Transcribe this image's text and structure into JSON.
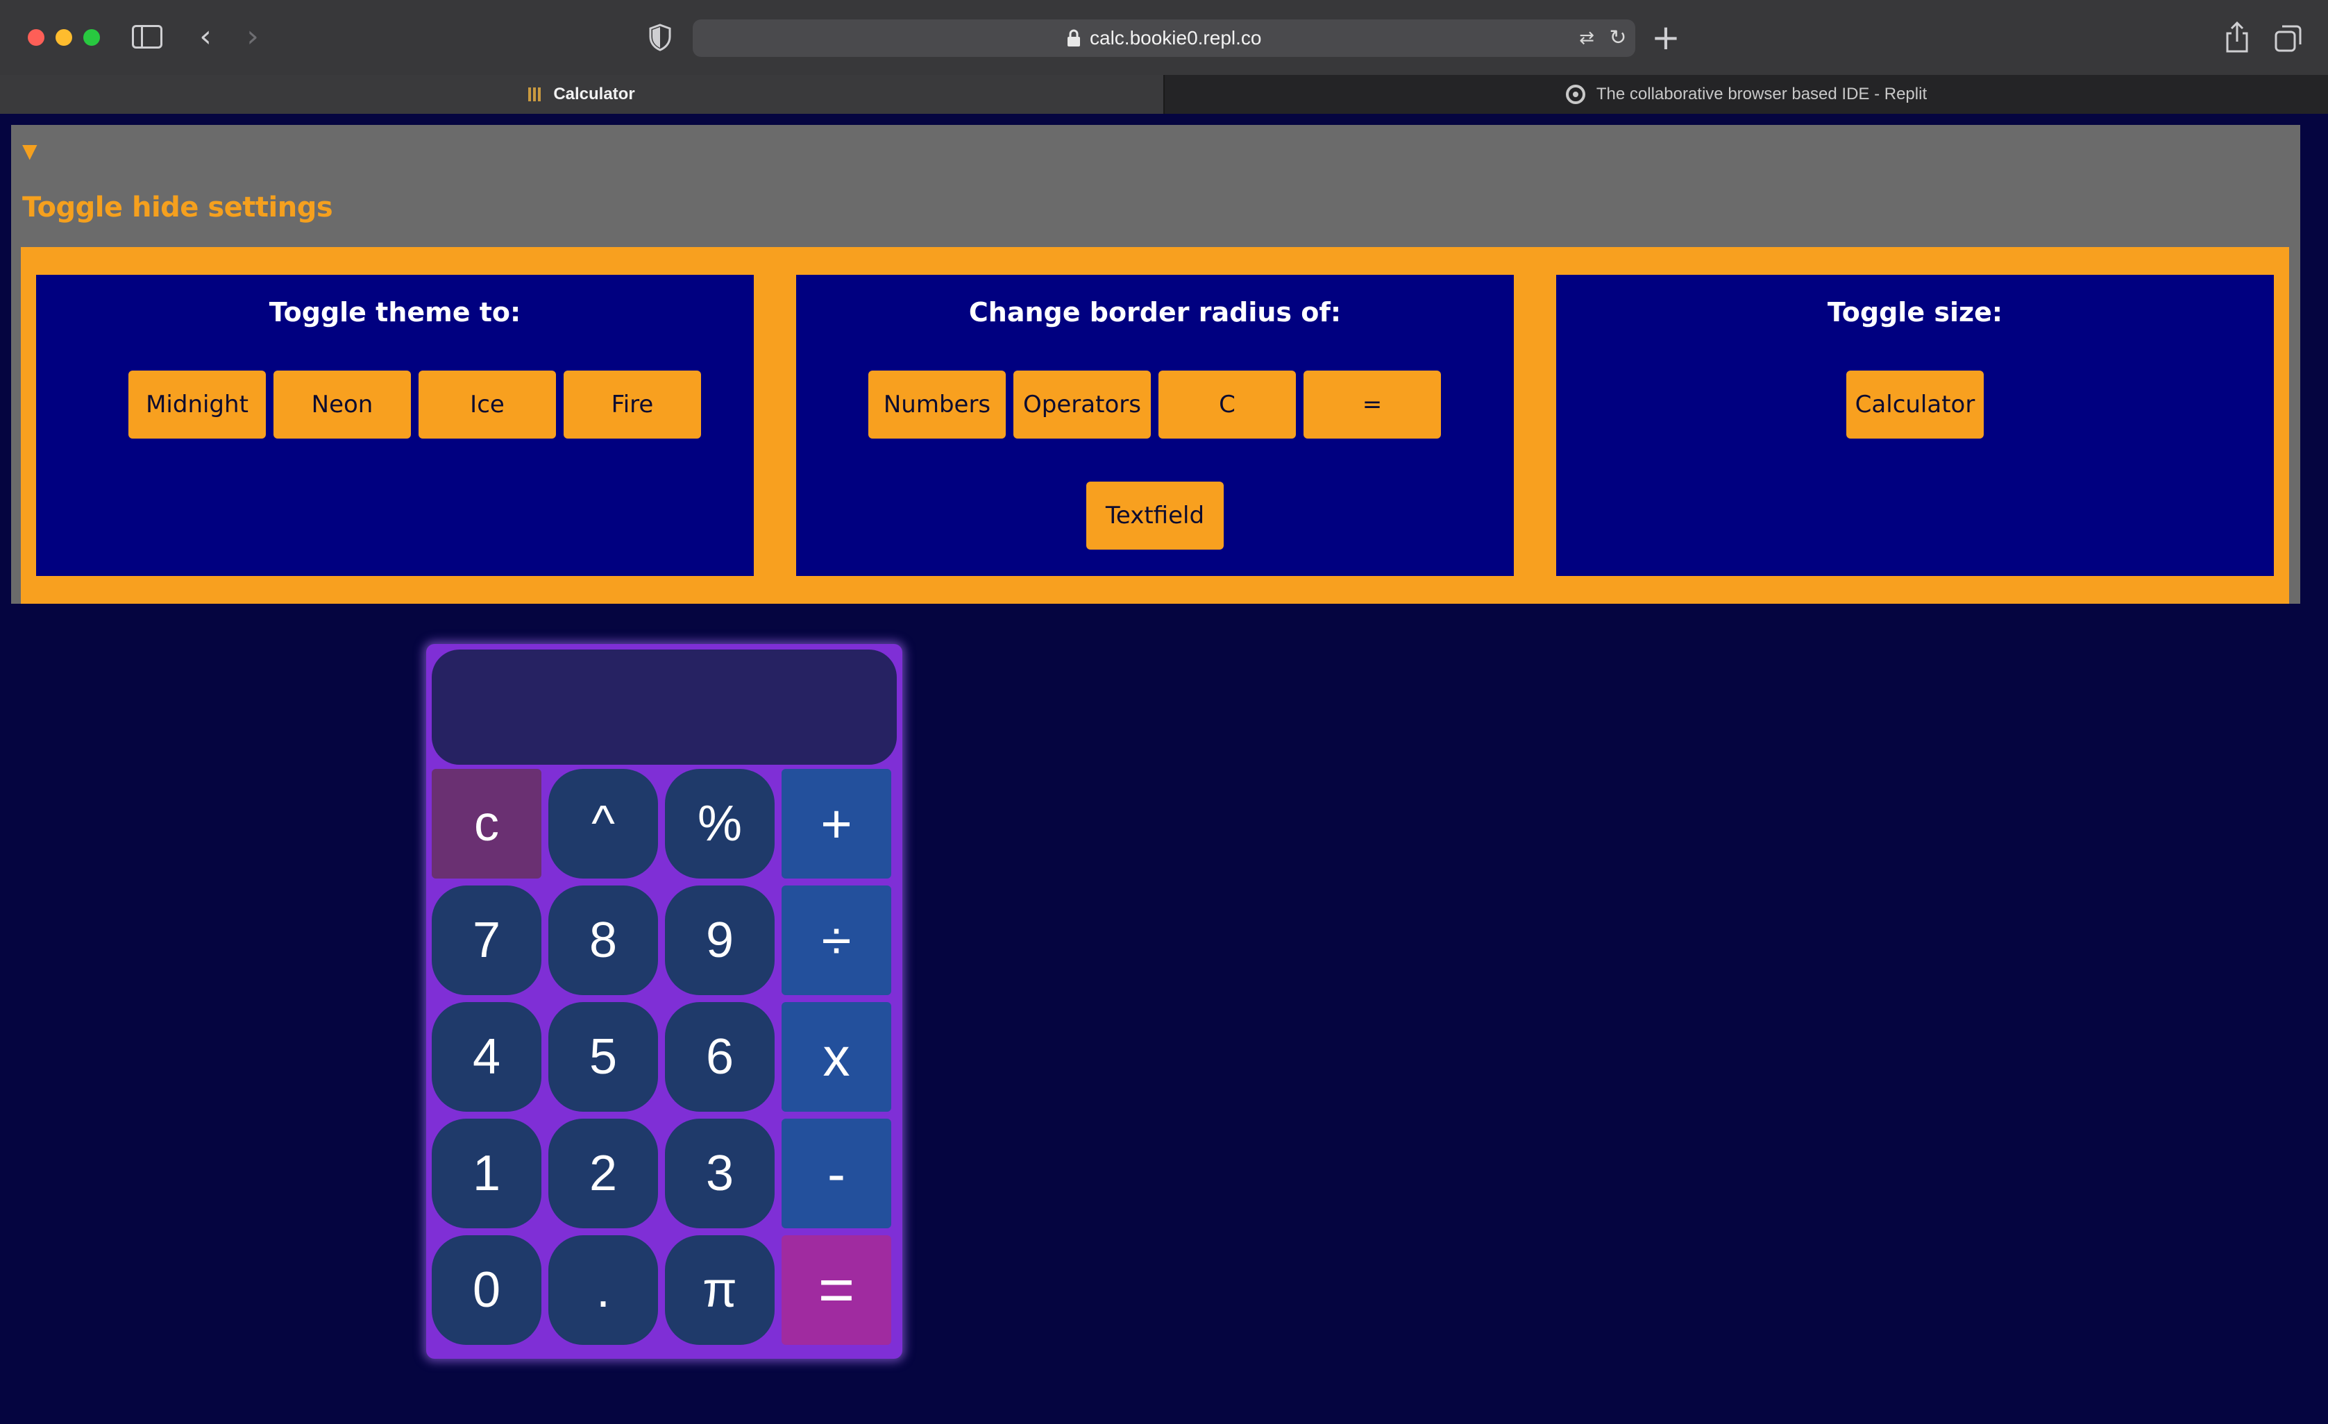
{
  "browser": {
    "url": "calc.bookie0.repl.co",
    "tabs": [
      {
        "label": "Calculator",
        "active": true
      },
      {
        "label": "The collaborative browser based IDE - Replit",
        "active": false
      }
    ]
  },
  "settings": {
    "disclosure_glyph": "▼",
    "title": "Toggle hide settings",
    "theme": {
      "title": "Toggle theme to:",
      "buttons": [
        "Midnight",
        "Neon",
        "Ice",
        "Fire"
      ]
    },
    "radius": {
      "title": "Change border radius of:",
      "buttons": [
        "Numbers",
        "Operators",
        "C",
        "=",
        "Textfield"
      ]
    },
    "size": {
      "title": "Toggle size:",
      "buttons": [
        "Calculator"
      ]
    }
  },
  "calculator": {
    "display_value": "",
    "keys": [
      [
        "c",
        "^",
        "%",
        "+"
      ],
      [
        "7",
        "8",
        "9",
        "÷"
      ],
      [
        "4",
        "5",
        "6",
        "x"
      ],
      [
        "1",
        "2",
        "3",
        "-"
      ],
      [
        "0",
        ".",
        "π",
        "="
      ]
    ]
  },
  "colors": {
    "accent": "#f8a01f",
    "panel": "#000080",
    "page_bg": "#050540",
    "calculator_body": "#7f2fd6",
    "key_number": "#1f3a6a",
    "key_operator": "#23509c",
    "key_clear": "#6a3072",
    "key_equals": "#a02ba0"
  }
}
